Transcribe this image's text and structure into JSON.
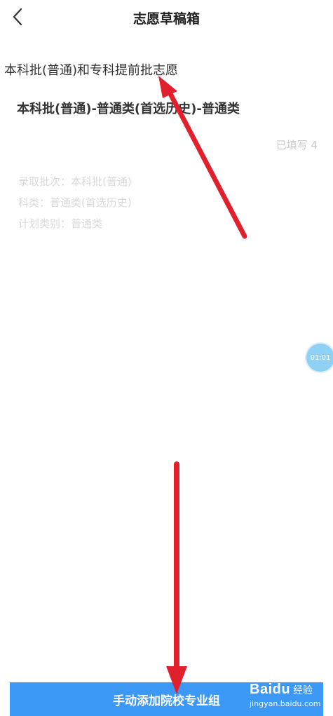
{
  "header": {
    "title": "志愿草稿箱",
    "back_icon": "chevron-left-icon"
  },
  "section": {
    "title": "本科批(普通)和专科提前批志愿"
  },
  "group": {
    "title": "本科批(普通)-普通类(首选历史)-普通类",
    "filled": "已填写 4",
    "info": [
      "录取批次：本科批(普通)",
      "科类：普通类(首选历史)",
      "计划类别：普通类"
    ]
  },
  "timer": {
    "label": "01:01"
  },
  "bottom": {
    "button_label": "手动添加院校专业组"
  },
  "watermark": {
    "logo": "Baidu",
    "text": "经验",
    "url": "jingyan.baidu.com"
  },
  "colors": {
    "primary": "#3b98f5",
    "annotation": "#e0202c"
  }
}
